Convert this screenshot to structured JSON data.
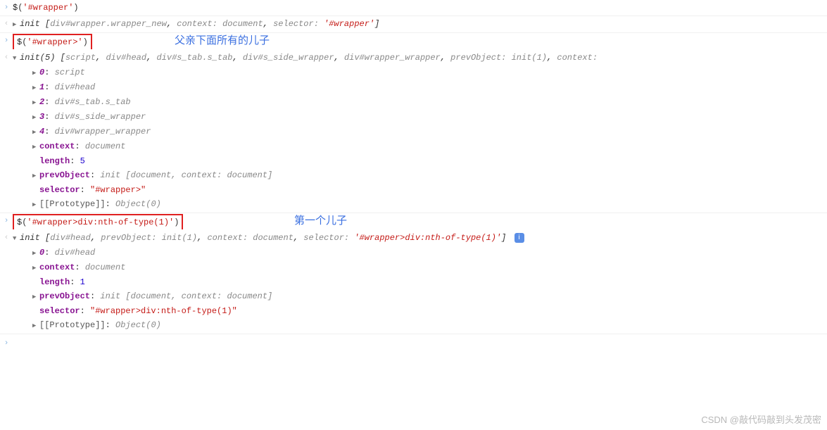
{
  "annotations": {
    "label1": "父亲下面所有的儿子",
    "label2": "第一个儿子"
  },
  "watermark": "CSDN @敲代码敲到头发茂密",
  "blocks": [
    {
      "input_parts": [
        "$",
        "(",
        "'#wrapper'",
        ")"
      ],
      "summary_prefix": "init ",
      "summary_items": [
        "div#wrapper.wrapper_new",
        ", ",
        "context: ",
        "document",
        ", ",
        "selector: ",
        "'#wrapper'"
      ]
    }
  ],
  "block2": {
    "input": "$('#wrapper>')",
    "annot": "父亲下面所有的儿子",
    "summary_count": 5,
    "summary_items": "[script, div#head, div#s_tab.s_tab, div#s_side_wrapper, div#wrapper_wrapper, prevObject: init(1), context:",
    "items": [
      {
        "k": "0",
        "v": "script"
      },
      {
        "k": "1",
        "v": "div#head"
      },
      {
        "k": "2",
        "v": "div#s_tab.s_tab"
      },
      {
        "k": "3",
        "v": "div#s_side_wrapper"
      },
      {
        "k": "4",
        "v": "div#wrapper_wrapper"
      }
    ],
    "context": "document",
    "length": 5,
    "prevObject": "init [document, context: document]",
    "selector": "\"#wrapper>\"",
    "proto": "Object(0)"
  },
  "block3": {
    "input": "$('#wrapper>div:nth-of-type(1)')",
    "annot": "第一个儿子",
    "summary": "init [div#head, prevObject: init(1), context: document, selector: '#wrapper>div:nth-of-type(1)']",
    "items": [
      {
        "k": "0",
        "v": "div#head"
      }
    ],
    "context": "document",
    "length": 1,
    "prevObject": "init [document, context: document]",
    "selector": "\"#wrapper>div:nth-of-type(1)\"",
    "proto": "Object(0)"
  }
}
